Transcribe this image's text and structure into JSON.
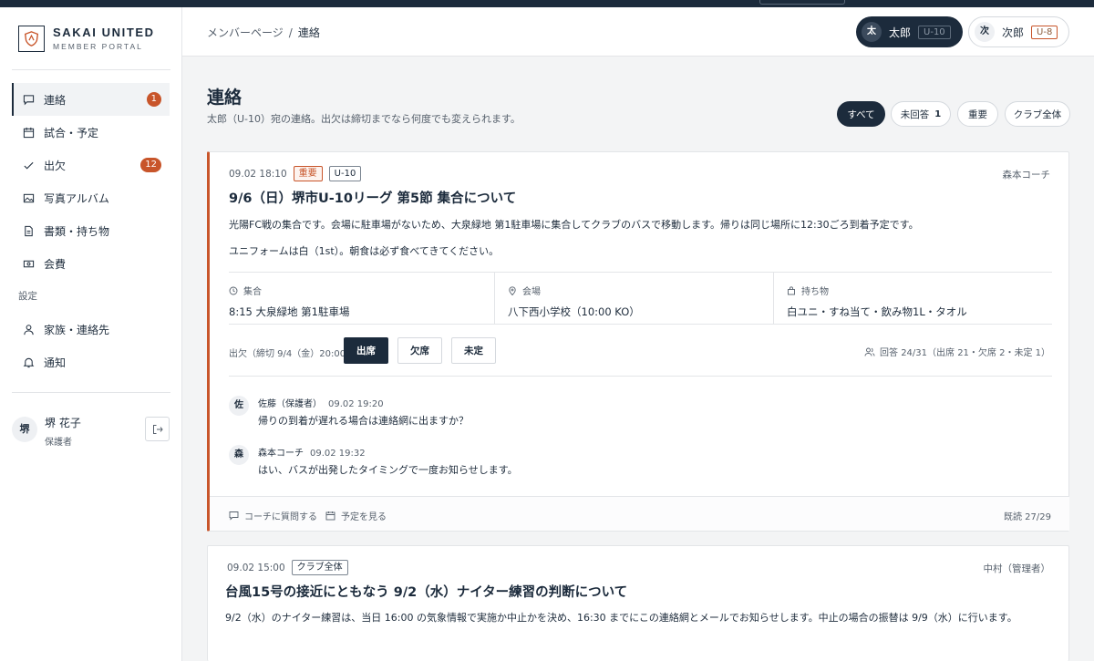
{
  "brand": {
    "name": "SAKAI UNITED",
    "sub": "MEMBER PORTAL"
  },
  "nav": {
    "items": [
      {
        "label": "連絡",
        "badge": "1",
        "icon": "message-icon"
      },
      {
        "label": "試合・予定",
        "icon": "calendar-icon"
      },
      {
        "label": "出欠",
        "badge": "12",
        "icon": "check-icon"
      },
      {
        "label": "写真アルバム",
        "icon": "image-icon"
      },
      {
        "label": "書類・持ち物",
        "icon": "document-icon"
      },
      {
        "label": "会費",
        "icon": "money-icon"
      }
    ],
    "settings_heading": "設定",
    "settings": [
      {
        "label": "家族・連絡先",
        "icon": "user-icon"
      },
      {
        "label": "通知",
        "icon": "bell-icon"
      }
    ]
  },
  "user": {
    "avatar": "堺",
    "name": "堺 花子",
    "role": "保護者"
  },
  "breadcrumb": {
    "parent": "メンバーページ",
    "separator": "/",
    "current": "連絡"
  },
  "children": [
    {
      "avatar": "太",
      "name": "太郎",
      "team": "U-10",
      "selected": true
    },
    {
      "avatar": "次",
      "name": "次郎",
      "team": "U-8",
      "selected": false
    }
  ],
  "page": {
    "title": "連絡",
    "subtitle": "太郎（U-10）宛の連絡。出欠は締切までなら何度でも変えられます。"
  },
  "filters": [
    {
      "label": "すべて",
      "active": true
    },
    {
      "label": "未回答",
      "count": "1"
    },
    {
      "label": "重要"
    },
    {
      "label": "クラブ全体"
    }
  ],
  "posts": [
    {
      "time": "09.02 18:10",
      "tags": [
        "重要",
        "U-10"
      ],
      "author": "森本コーチ",
      "title": "9/6（日）堺市U-10リーグ 第5節 集合について",
      "body": [
        "光陽FC戦の集合です。会場に駐車場がないため、大泉緑地 第1駐車場に集合してクラブのバスで移動します。帰りは同じ場所に12:30ごろ到着予定です。",
        "ユニフォームは白（1st）。朝食は必ず食べてきてください。"
      ],
      "info": [
        {
          "label": "集合",
          "value": "8:15 大泉緑地 第1駐車場",
          "icon": "clock-icon"
        },
        {
          "label": "会場",
          "value": "八下西小学校（10:00 KO）",
          "icon": "pin-icon"
        },
        {
          "label": "持ち物",
          "value": "白ユニ・すね当て・飲み物1L・タオル",
          "icon": "bag-icon"
        }
      ],
      "attendance": {
        "label": "出欠（締切 9/4（金）20:00）",
        "options": [
          "出席",
          "欠席",
          "未定"
        ],
        "selected": "出席",
        "summary": "回答 24/31（出席 21・欠席 2・未定 1）"
      },
      "comments": [
        {
          "avatar": "佐",
          "author": "佐藤（保護者）",
          "time": "09.02 19:20",
          "text": "帰りの到着が遅れる場合は連絡網に出ますか？"
        },
        {
          "avatar": "森",
          "author": "森本コーチ",
          "time": "09.02 19:32",
          "text": "はい、バスが出発したタイミングで一度お知らせします。"
        }
      ],
      "footer": {
        "ask": "コーチに質問する",
        "schedule": "予定を見る",
        "read": "既読 27/29"
      }
    },
    {
      "time": "09.02 15:00",
      "tags": [
        "クラブ全体"
      ],
      "author": "中村（管理者）",
      "title": "台風15号の接近にともなう 9/2（水）ナイター練習の判断について",
      "body": [
        "9/2（水）のナイター練習は、当日 16:00 の気象情報で実施か中止かを決め、16:30 までにこの連絡網とメールでお知らせします。中止の場合の振替は 9/9（水）に行います。"
      ]
    }
  ],
  "colors": {
    "navy": "#1c2b3c",
    "accent": "#c8552a",
    "bg": "#f3f4f5"
  }
}
